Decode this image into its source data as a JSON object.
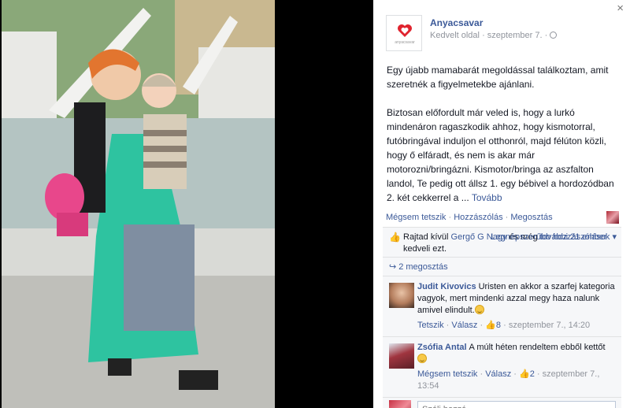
{
  "window": {
    "close_label": "×"
  },
  "post": {
    "page_name": "Anyacsavar",
    "page_type": "Kedvelt oldal",
    "separator": "·",
    "date": "szeptember 7.",
    "logo_text": "anyacsavar",
    "paragraph1": "Egy újabb mamabarát megoldással találkoztam, amit szeretnék a figyelmetekbe ajánlani.",
    "paragraph2": "Biztosan előfordult már veled is, hogy a lurkó mindenáron ragaszkodik ahhoz, hogy kismotorral, futóbringával induljon el otthonról, majd félúton közli, hogy ő elfáradt, és nem is akar már motorozni/bringázni. Kismotor/bringa az aszfalton landol, Te pedig ott állsz 1. egy bébivel a hordozódban 2. két cekkerrel a ... ",
    "see_more": "Tovább"
  },
  "actions": {
    "unlike": "Mégsem tetszik",
    "comment": "Hozzászólás",
    "share": "Megosztás",
    "dot": "·"
  },
  "feedback": {
    "likes_prefix": "Rajtad kívül ",
    "likes_person": "Gergő G Nagy",
    "likes_mid": " és még ",
    "likes_others": "további 21 ember",
    "likes_suffix": " kedveli ezt.",
    "top_comments": "Legnépszerűbb hozzászólások",
    "shares": "2 megosztás"
  },
  "comments": [
    {
      "author": "Judit Kivovics",
      "text": "Uristen en akkor a szarfej kategoria vagyok, mert mindenki azzal megy haza nalunk amivel elindult.",
      "action1": "Tetszik",
      "action2": "Válasz",
      "likes": "8",
      "date": "szeptember 7., 14:20"
    },
    {
      "author": "Zsófia Antal",
      "text": "A múlt héten rendeltem ebből kettőt",
      "action1": "Mégsem tetszik",
      "action2": "Válasz",
      "likes": "2",
      "date": "szeptember 7., 13:54"
    }
  ],
  "compose": {
    "placeholder": "Szólj hozzá..."
  },
  "colors": {
    "link": "#3b5998",
    "meta": "#90949c",
    "feedback_bg": "#f6f7f9",
    "brand_red": "#e0242f"
  }
}
